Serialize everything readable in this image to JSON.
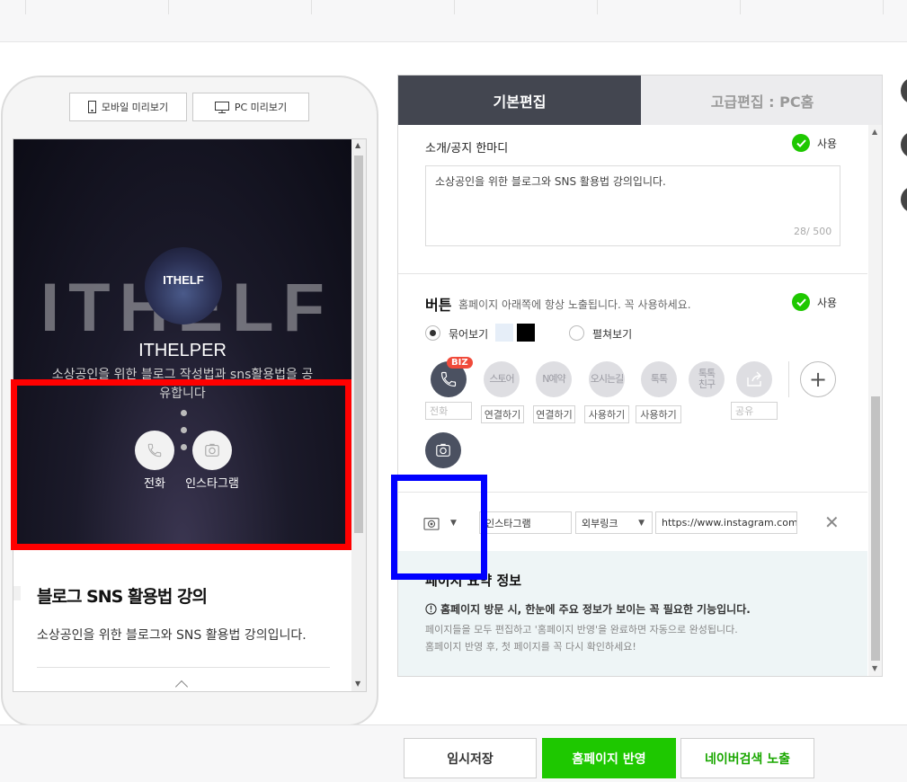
{
  "preview": {
    "mobile_label": "모바일 미리보기",
    "pc_label": "PC 미리보기"
  },
  "mobile_screen": {
    "background_text": "ITHELF",
    "logo_text": "ITHELF",
    "title": "ITHELPER",
    "description": "소상공인을 위한 블로그 작성법과 sns활용법을 공유합니다",
    "actions": [
      {
        "label": "전화",
        "icon": "phone-icon"
      },
      {
        "label": "인스타그램",
        "icon": "camera-icon"
      }
    ],
    "article_title": "블로그 SNS 활용법 강의",
    "article_desc": "소상공인을 위한 블로그와 SNS 활용법 강의입니다."
  },
  "editor": {
    "tabs": [
      {
        "label": "기본편집",
        "active": true
      },
      {
        "label": "고급편집 : PC홈",
        "active": false
      }
    ],
    "intro_section": {
      "label": "소개/공지 한마디",
      "use_label": "사용",
      "text": "소상공인을 위한 블로그와 SNS 활용법 강의입니다.",
      "counter": "28/ 500"
    },
    "button_section": {
      "title": "버튼",
      "subtitle": "홈페이지 아래쪽에 항상 노출됩니다. 꼭 사용하세요.",
      "use_label": "사용",
      "radio_bundle": "묶어보기",
      "radio_spread": "펼쳐보기",
      "biz_badge": "BIZ",
      "icons": [
        {
          "label": "",
          "icon": "phone-icon",
          "caption": "전화",
          "caption_placeholder": true
        },
        {
          "label": "스토어",
          "caption": "연결하기"
        },
        {
          "label": "N예약",
          "caption": "연결하기"
        },
        {
          "label": "오시는길",
          "caption": "사용하기"
        },
        {
          "label": "톡톡",
          "caption": "사용하기"
        },
        {
          "label": "톡톡\n친구",
          "caption": ""
        },
        {
          "label": "",
          "icon": "share-icon",
          "caption": "공유",
          "caption_placeholder": true
        }
      ],
      "plus_label": "+"
    },
    "link_row": {
      "name_value": "인스타그램",
      "link_type": "외부링크",
      "url": "https://www.instagram.com/t"
    },
    "summary": {
      "heading": "페이지 요약 정보",
      "line1": "홈페이지 방문 시, 한눈에 주요 정보가 보이는 꼭 필요한 기능입니다.",
      "line2": "페이지들을 모두 편집하고 '홈페이지 반영'을 완료하면 자동으로 완성됩니다.",
      "line3": "홈페이지 반영 후, 첫 페이지를 꼭 다시 확인하세요!"
    }
  },
  "bottom": {
    "save_label": "임시저장",
    "apply_label": "홈페이지 반영",
    "naver_label": "네이버검색 노출"
  },
  "colors": {
    "accent_green": "#1ec800",
    "tab_dark": "#434650",
    "annotation_red": "#ff0000",
    "annotation_blue": "#0000ff"
  }
}
